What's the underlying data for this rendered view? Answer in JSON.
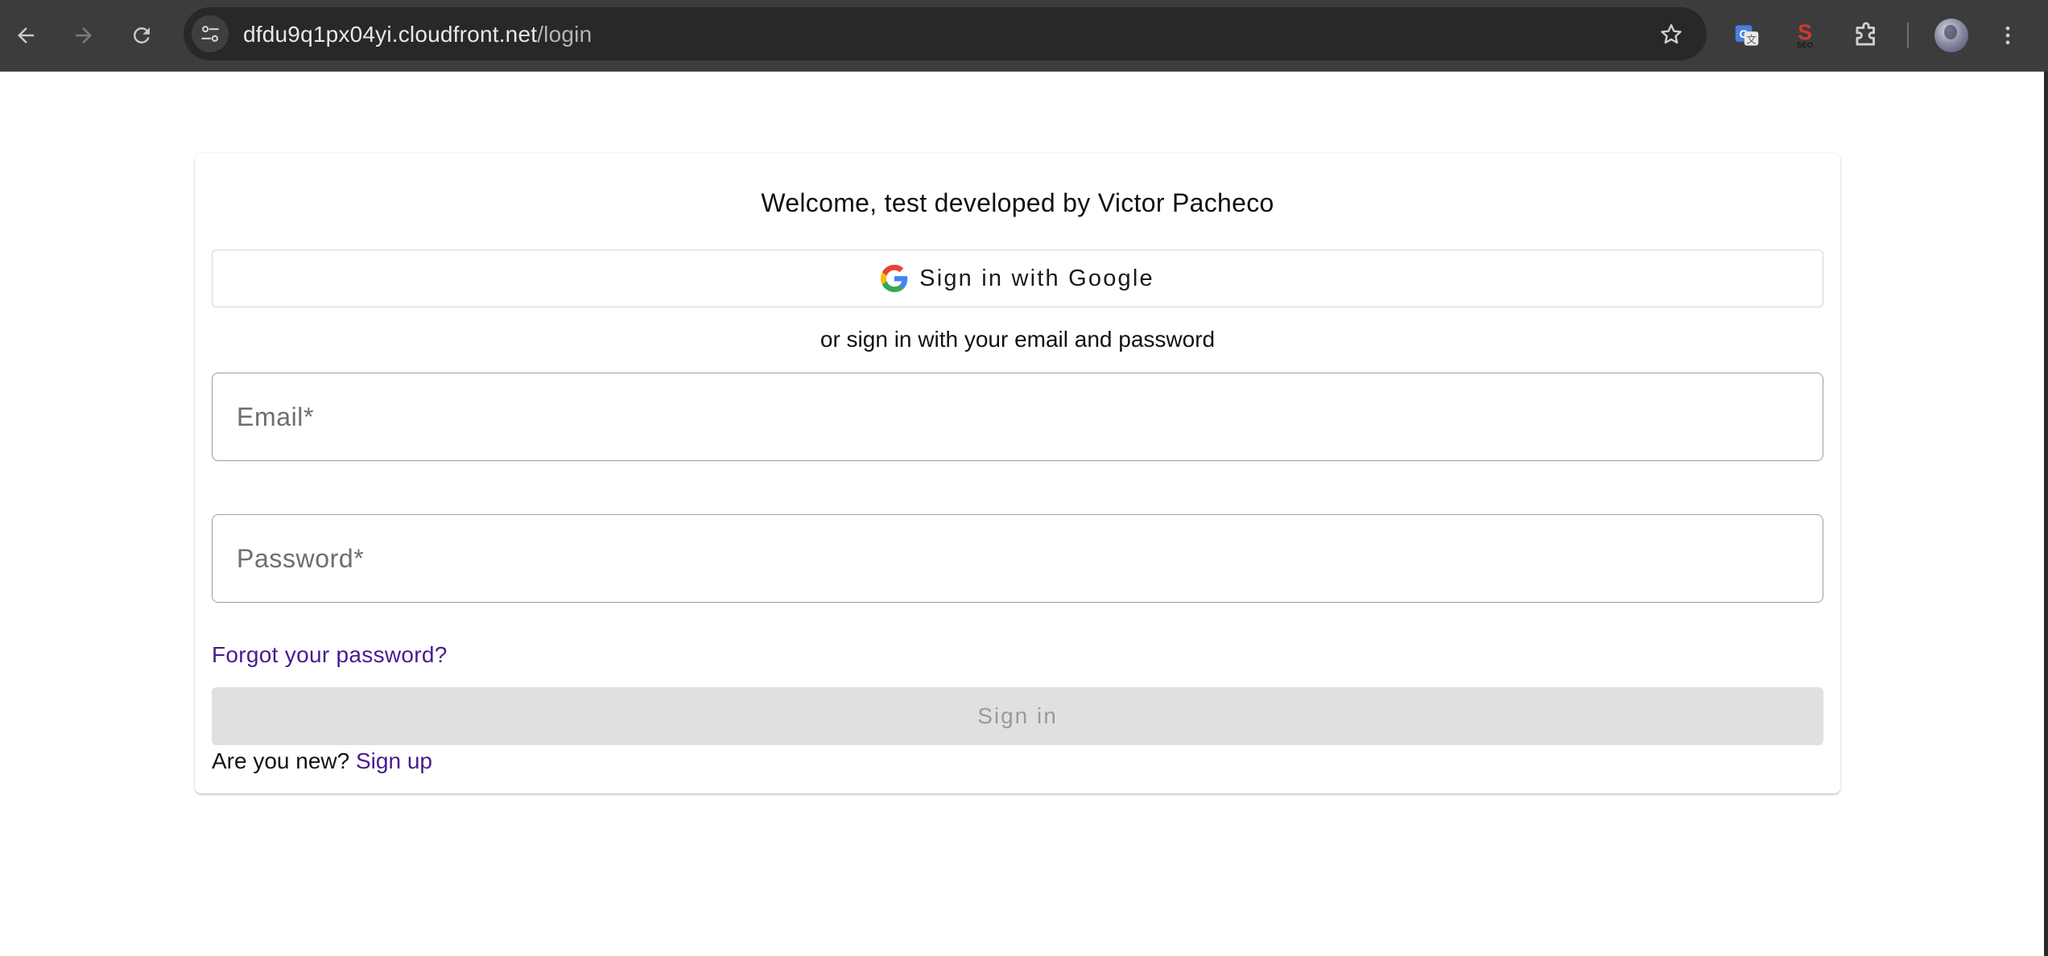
{
  "browser": {
    "url_host": "dfdu9q1px04yi.cloudfront.net",
    "url_path": "/login"
  },
  "extensions": [
    {
      "name": "translate-extension-icon"
    },
    {
      "name": "seo-extension-icon"
    },
    {
      "name": "puzzle-extensions-icon"
    }
  ],
  "login": {
    "welcome": "Welcome, test developed by Victor Pacheco",
    "google_button_label": "Sign in with Google",
    "divider_text": "or sign in with your email and password",
    "email_placeholder": "Email*",
    "email_value": "",
    "password_placeholder": "Password*",
    "password_value": "",
    "forgot_link": "Forgot your password?",
    "sign_in_label": "Sign in",
    "sign_in_disabled": true,
    "new_prompt": "Are you new?",
    "sign_up_link": "Sign up"
  },
  "colors": {
    "toolbar": "#3c3c3c",
    "omnibox": "#282828",
    "link": "#4a1a91",
    "disabled_button_bg": "#e0e0e0",
    "disabled_button_text": "#9a9a9a"
  }
}
